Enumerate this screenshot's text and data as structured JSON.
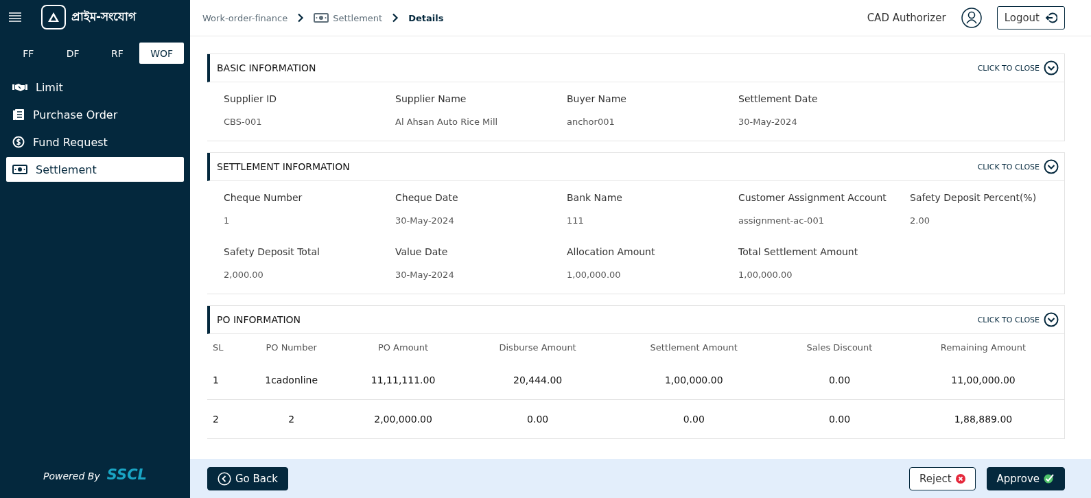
{
  "sidebar": {
    "brand": "প্রাইম-সংযোগ",
    "tabs": [
      {
        "label": "FF",
        "selected": false
      },
      {
        "label": "DF",
        "selected": false
      },
      {
        "label": "RF",
        "selected": false
      },
      {
        "label": "WOF",
        "selected": true
      }
    ],
    "items": [
      {
        "label": "Limit",
        "kind": "handshake",
        "selected": false
      },
      {
        "label": "Purchase Order",
        "kind": "document",
        "selected": false
      },
      {
        "label": "Fund Request",
        "kind": "coin",
        "selected": false
      },
      {
        "label": "Settlement",
        "kind": "cash",
        "selected": true
      }
    ],
    "powered_by": "Powered By",
    "powered_brand": "SSCL"
  },
  "breadcrumb": [
    {
      "label": "Work-order-finance",
      "kind": "text"
    },
    {
      "label": "Settlement",
      "kind": "cash"
    },
    {
      "label": "Details",
      "kind": "current"
    }
  ],
  "user": {
    "name": "CAD Authorizer",
    "logout": "Logout"
  },
  "sections": [
    {
      "title": "BASIC INFORMATION",
      "toggle": "CLICK TO CLOSE",
      "kind": "fields",
      "fields": [
        {
          "label": "Supplier ID",
          "value": "CBS-001"
        },
        {
          "label": "Supplier Name",
          "value": "Al Ahsan Auto Rice Mill"
        },
        {
          "label": "Buyer Name",
          "value": "anchor001"
        },
        {
          "label": "Settlement Date",
          "value": "30-May-2024"
        }
      ]
    },
    {
      "title": "SETTLEMENT INFORMATION",
      "toggle": "CLICK TO CLOSE",
      "kind": "fields",
      "fields": [
        {
          "label": "Cheque Number",
          "value": "1"
        },
        {
          "label": "Cheque Date",
          "value": "30-May-2024"
        },
        {
          "label": "Bank Name",
          "value": "111"
        },
        {
          "label": "Customer Assignment Account",
          "value": "assignment-ac-001"
        },
        {
          "label": "Safety Deposit Percent(%)",
          "value": "2.00"
        },
        {
          "label": "Safety Deposit Total",
          "value": "2,000.00"
        },
        {
          "label": "Value Date",
          "value": "30-May-2024"
        },
        {
          "label": "Allocation Amount",
          "value": "1,00,000.00"
        },
        {
          "label": "Total Settlement Amount",
          "value": "1,00,000.00"
        }
      ]
    },
    {
      "title": "PO INFORMATION",
      "toggle": "CLICK TO CLOSE",
      "kind": "table",
      "columns": [
        "SL",
        "PO Number",
        "PO Amount",
        "Disburse Amount",
        "Settlement Amount",
        "Sales Discount",
        "Remaining Amount"
      ],
      "rows": [
        [
          "1",
          "1cadonline",
          "11,11,111.00",
          "20,444.00",
          "1,00,000.00",
          "0.00",
          "11,00,000.00"
        ],
        [
          "2",
          "2",
          "2,00,000.00",
          "0.00",
          "0.00",
          "0.00",
          "1,88,889.00"
        ]
      ]
    }
  ],
  "footer": {
    "back": "Go Back",
    "reject": "Reject",
    "approve": "Approve"
  }
}
